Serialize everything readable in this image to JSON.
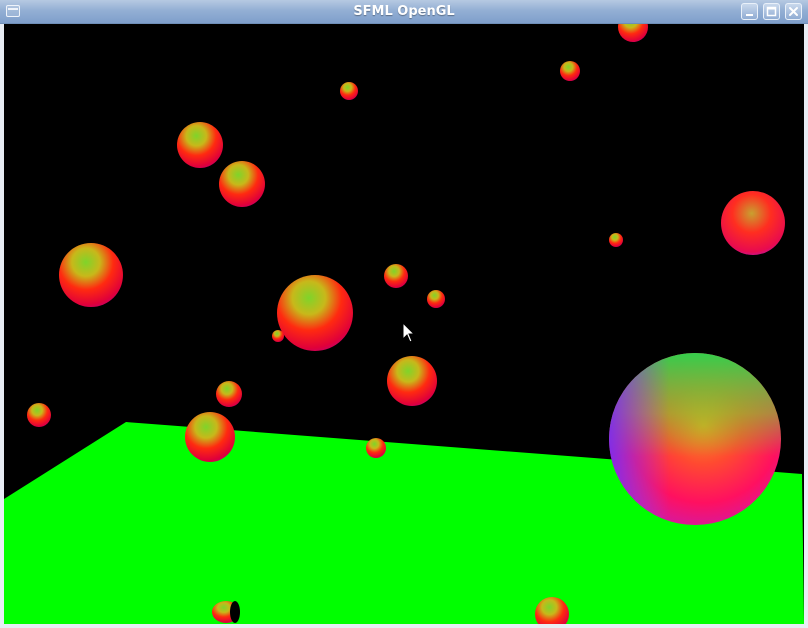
{
  "window": {
    "title": "SFML OpenGL",
    "buttons": [
      "minimize",
      "maximize",
      "close"
    ]
  },
  "scene": {
    "background_color": "#000000",
    "floor_color": "#00ff00",
    "sphere_shading": "rgb-normal-colored",
    "cursor": "arrow-pointer"
  }
}
